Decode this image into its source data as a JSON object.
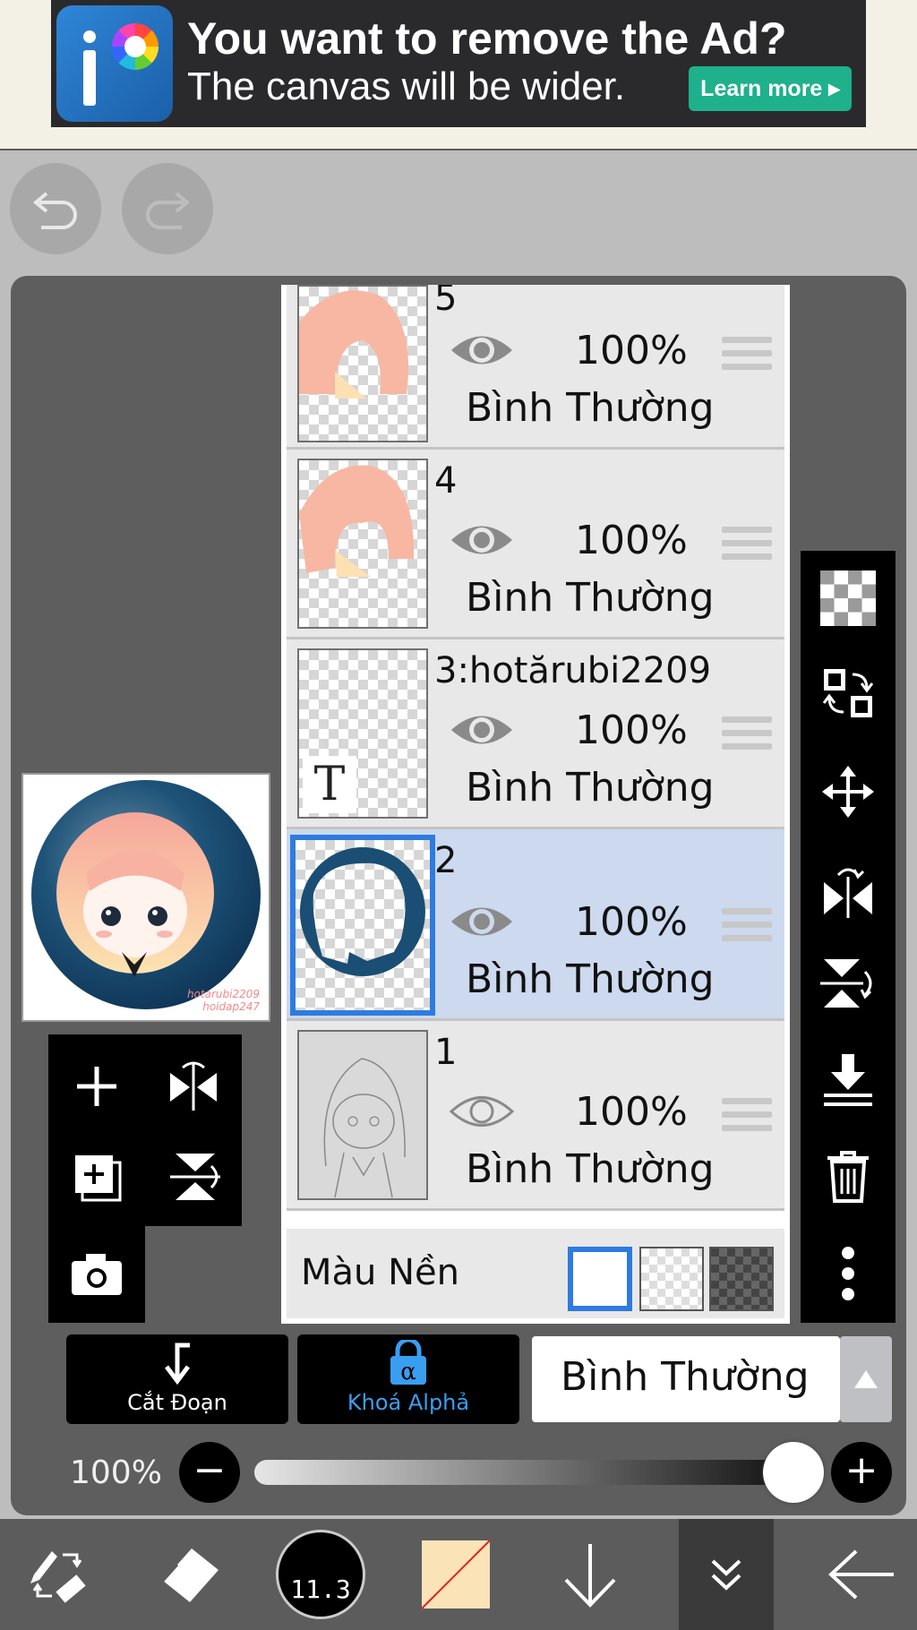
{
  "ad": {
    "title": "You want to remove the Ad?",
    "subtitle": "The canvas will be wider.",
    "button_label": "Learn more ▸"
  },
  "layers": [
    {
      "name": "5",
      "opacity": "100%",
      "blend": "Bình Thường",
      "visible": true,
      "selected": false
    },
    {
      "name": "4",
      "opacity": "100%",
      "blend": "Bình Thường",
      "visible": true,
      "selected": false
    },
    {
      "name": "3:hotărubi2209",
      "opacity": "100%",
      "blend": "Bình Thường",
      "visible": true,
      "selected": false
    },
    {
      "name": "2",
      "opacity": "100%",
      "blend": "Bình Thường",
      "visible": true,
      "selected": true
    },
    {
      "name": "1",
      "opacity": "100%",
      "blend": "Bình Thường",
      "visible": false,
      "selected": false
    }
  ],
  "background_row": {
    "label": "Màu Nền",
    "options": [
      "white",
      "transparent",
      "dark-checker"
    ],
    "selected": "white"
  },
  "preview": {
    "watermark_line1": "hotarubi2209",
    "watermark_line2": "hoidap247"
  },
  "text_layer_glyph": "T",
  "actions": {
    "clipping_label": "Cắt Đoạn",
    "alpha_lock_label": "Khoá Alphả",
    "blend_mode_value": "Bình Thường"
  },
  "opacity_slider": {
    "label": "100%",
    "value": 1.0,
    "minus": "−",
    "plus": "+"
  },
  "brush": {
    "size": "11.3"
  },
  "colors": {
    "accent_blue": "#2e7be0",
    "selected_layer_bg": "#ccd9ee",
    "alpha_lock_blue": "#3a9ef0",
    "ad_button_green": "#1fb08c",
    "current_color": "#fbe3b8"
  },
  "icons": {
    "undo": "undo-icon",
    "redo": "redo-icon",
    "eye": "eye-icon",
    "drag": "drag-handle-icon"
  }
}
